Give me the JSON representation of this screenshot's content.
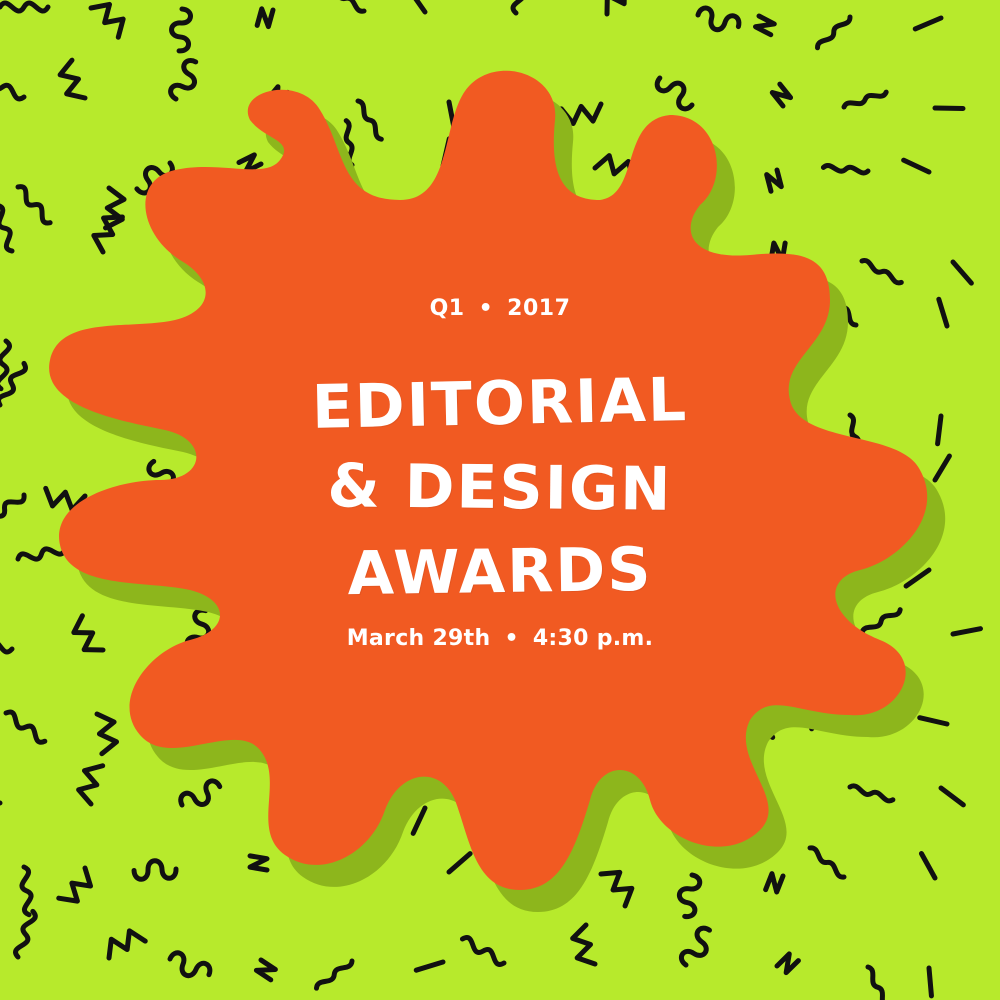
{
  "colors": {
    "background": "#B7EA2C",
    "squiggle": "#111111",
    "splat": "#F15A22",
    "splat_shadow": "#8DB61C",
    "text": "#FFFFFF"
  },
  "event": {
    "quarter": "Q1",
    "separator": "•",
    "year": "2017",
    "title_lines": [
      "EDITORIAL",
      "& DESIGN",
      "AWARDS"
    ],
    "date": "March 29th",
    "time": "4:30 p.m."
  }
}
